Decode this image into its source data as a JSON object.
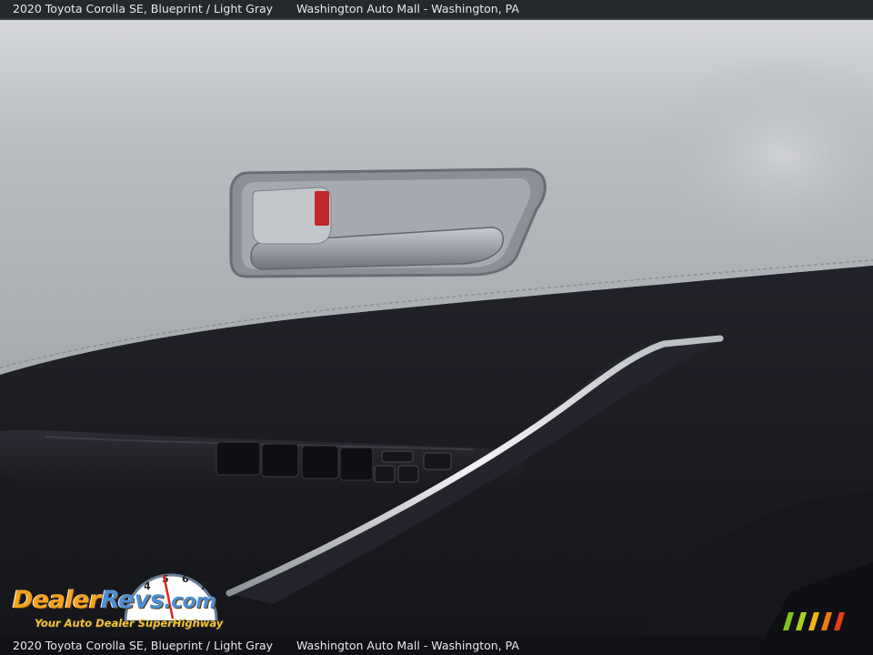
{
  "caption": {
    "vehicle": "2020 Toyota Corolla SE,  Blueprint / Light Gray",
    "dealer": "Washington Auto Mall - Washington, PA"
  },
  "watermark": {
    "brand_part1": "Dealer",
    "brand_part2": "Revs",
    "brand_suffix": ".com",
    "tagline": "Your Auto Dealer SuperHighway",
    "gauge_digits": [
      "4",
      "5",
      "6",
      "7"
    ],
    "colors": {
      "orange": "#f3a21f",
      "blue": "#4b8fd6"
    }
  },
  "photo": {
    "subject": "door-panel-interior",
    "colors": {
      "upper_trim": "#b8bbc0",
      "lower_trim": "#1c1d22",
      "handle": "#9ea3aa",
      "accent_red": "#c0282c"
    }
  },
  "badge": {
    "stripe_colors": [
      "#7fc31c",
      "#a9d11a",
      "#f2b21a",
      "#f07a14",
      "#e83e1a"
    ]
  }
}
